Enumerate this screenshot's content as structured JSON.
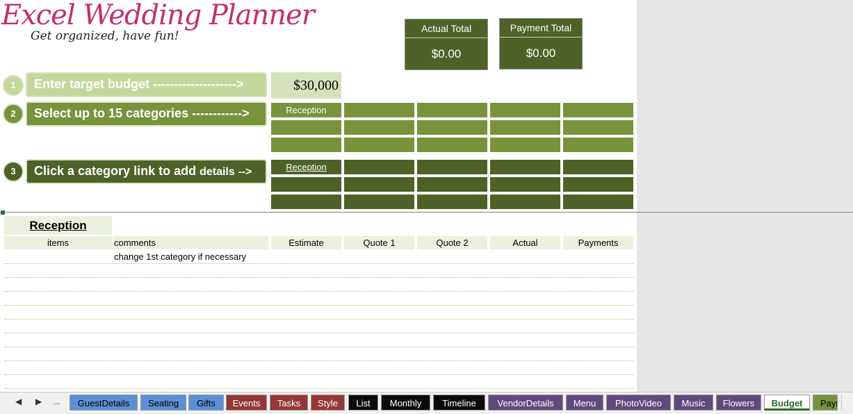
{
  "logo": {
    "title": "Excel Wedding Planner",
    "subtitle": "Get organized, have fun!"
  },
  "totals": {
    "actual_label": "Actual  Total",
    "actual_value": "$0.00",
    "payment_label": "Payment Total",
    "payment_value": "$0.00"
  },
  "steps": [
    {
      "number": "1",
      "label": "Enter target budget -------------------->",
      "small": ""
    },
    {
      "number": "2",
      "label": "Select up to 15 categories ------------>",
      "small": ""
    },
    {
      "number": "3",
      "label": "Click a category link to add ",
      "small": "details -->"
    }
  ],
  "budget": {
    "value": "$30,000"
  },
  "category_grid": {
    "first": "Reception"
  },
  "category_links": {
    "first": "Reception"
  },
  "section": {
    "title": "Reception",
    "columns": [
      "items",
      "comments",
      "Estimate",
      "Quote 1",
      "Quote 2",
      "Actual",
      "Payments"
    ],
    "rows": [
      {
        "items": "",
        "comments": "change 1st category if necessary"
      }
    ]
  },
  "sheet_tabs": {
    "nav_prev": "◀",
    "nav_next": "▶",
    "nav_more": "...",
    "tabs": [
      {
        "label": "GuestDetails",
        "color": "#5b8fd6"
      },
      {
        "label": "Seating",
        "color": "#5b8fd6"
      },
      {
        "label": "Gifts",
        "color": "#5b8fd6"
      },
      {
        "label": "Events",
        "color": "#953735"
      },
      {
        "label": "Tasks",
        "color": "#953735"
      },
      {
        "label": "Style",
        "color": "#953735"
      },
      {
        "label": "List",
        "color": "#0a0a0a"
      },
      {
        "label": "Monthly",
        "color": "#0a0a0a"
      },
      {
        "label": "Timeline",
        "color": "#0a0a0a"
      },
      {
        "label": "VendorDetails",
        "color": "#604a7b"
      },
      {
        "label": "Menu",
        "color": "#604a7b"
      },
      {
        "label": "PhotoVideo",
        "color": "#604a7b"
      },
      {
        "label": "Music",
        "color": "#604a7b"
      },
      {
        "label": "Flowers",
        "color": "#604a7b"
      },
      {
        "label": "Budget",
        "color": "#ffffff",
        "active": true
      },
      {
        "label": "Payr",
        "color": "#77933c"
      }
    ]
  },
  "colors": {
    "dark_green": "#4e6228",
    "mid_green": "#77933c",
    "light_green": "#c4d79b",
    "pale_green": "#ebf1de",
    "logo_pink": "#c2306e"
  }
}
